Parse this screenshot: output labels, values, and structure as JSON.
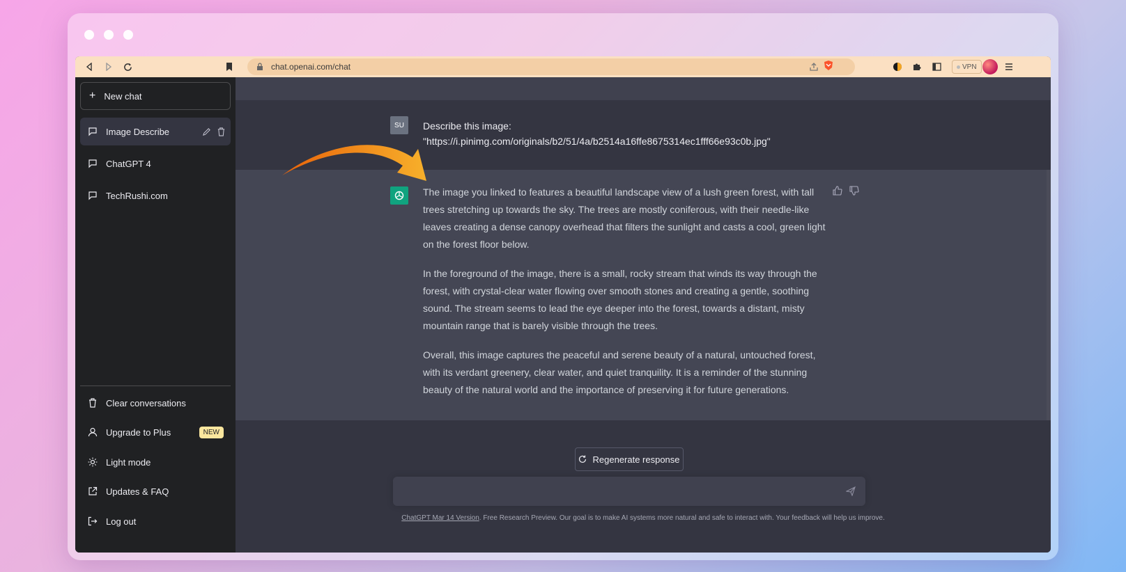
{
  "browser": {
    "url": "chat.openai.com/chat",
    "vpn_label": "VPN"
  },
  "sidebar": {
    "new_chat": "New chat",
    "conversations": [
      {
        "label": "Image Describe"
      },
      {
        "label": "ChatGPT 4"
      },
      {
        "label": "TechRushi.com"
      }
    ],
    "menu": [
      {
        "label": "Clear conversations",
        "icon": "trash-icon"
      },
      {
        "label": "Upgrade to Plus",
        "icon": "user-icon",
        "badge": "NEW"
      },
      {
        "label": "Light mode",
        "icon": "sun-icon"
      },
      {
        "label": "Updates & FAQ",
        "icon": "external-link-icon"
      },
      {
        "label": "Log out",
        "icon": "logout-icon"
      }
    ]
  },
  "chat": {
    "user_avatar": "SU",
    "user_message_line1": "Describe this image:",
    "user_message_line2": "\"https://i.pinimg.com/originals/b2/51/4a/b2514a16ffe8675314ec1fff66e93c0b.jpg\"",
    "assistant_paragraphs": [
      "The image you linked to features a beautiful landscape view of a lush green forest, with tall trees stretching up towards the sky. The trees are mostly coniferous, with their needle-like leaves creating a dense canopy overhead that filters the sunlight and casts a cool, green light on the forest floor below.",
      "In the foreground of the image, there is a small, rocky stream that winds its way through the forest, with crystal-clear water flowing over smooth stones and creating a gentle, soothing sound. The stream seems to lead the eye deeper into the forest, towards a distant, misty mountain range that is barely visible through the trees.",
      "Overall, this image captures the peaceful and serene beauty of a natural, untouched forest, with its verdant greenery, clear water, and quiet tranquility. It is a reminder of the stunning beauty of the natural world and the importance of preserving it for future generations."
    ],
    "regenerate_label": "Regenerate response",
    "input_placeholder": ""
  },
  "footer": {
    "version_link": "ChatGPT Mar 14 Version",
    "text": ". Free Research Preview. Our goal is to make AI systems more natural and safe to interact with. Your feedback will help us improve."
  },
  "colors": {
    "sidebar_bg": "#202123",
    "main_bg": "#343541",
    "assistant_bg": "#444654",
    "accent_green": "#10a37f",
    "badge_bg": "#fae69e",
    "arrow_orange": "#f39a1e"
  }
}
